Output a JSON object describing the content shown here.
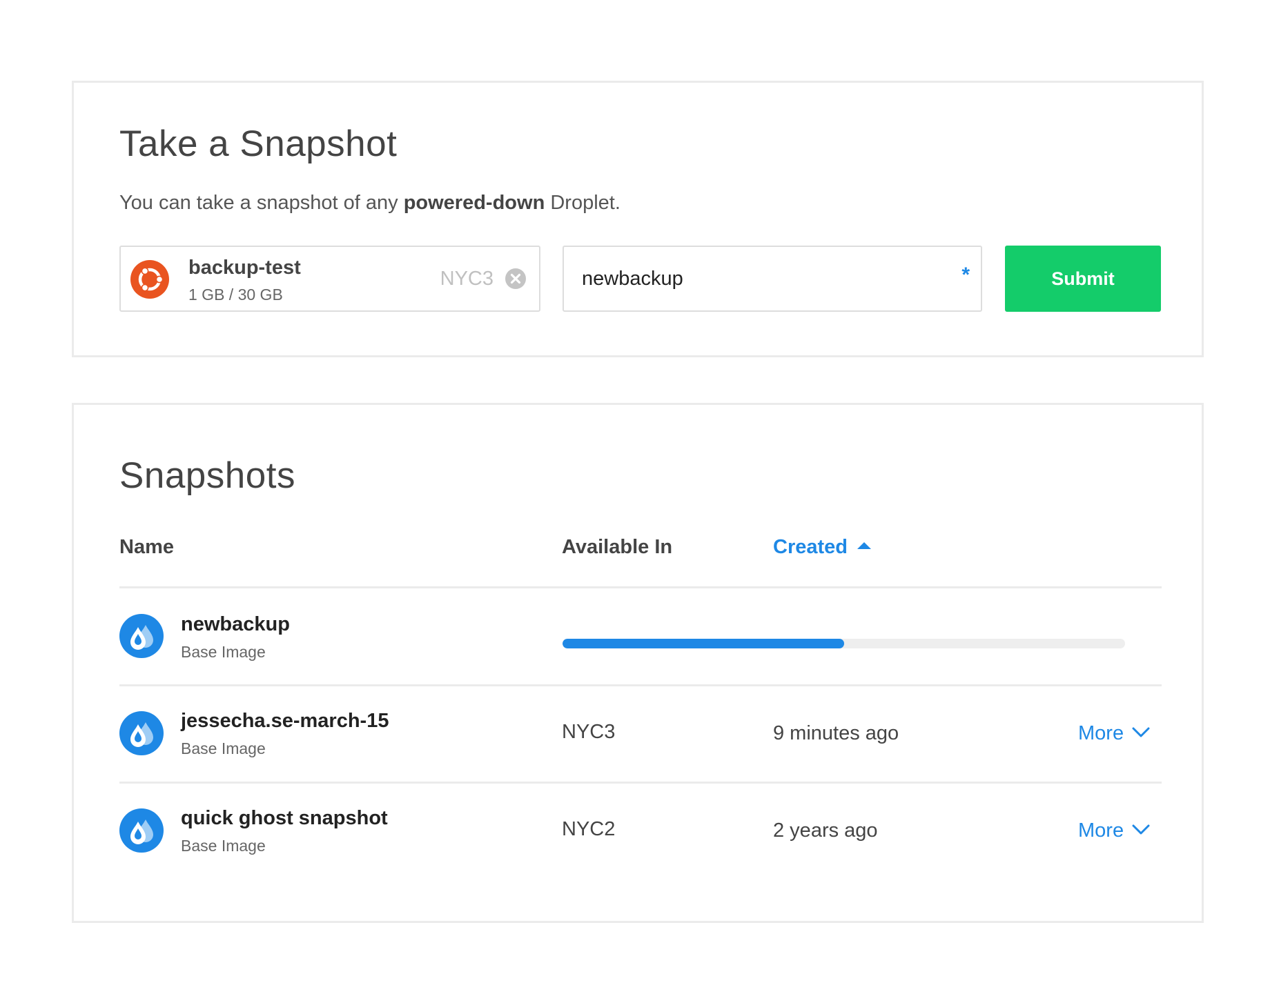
{
  "take_snapshot": {
    "title": "Take a Snapshot",
    "description_prefix": "You can take a snapshot of any ",
    "description_bold": "powered-down",
    "description_suffix": " Droplet.",
    "droplet": {
      "name": "backup-test",
      "size": "1 GB / 30 GB",
      "region": "NYC3",
      "icon": "ubuntu-icon"
    },
    "snapshot_name_value": "newbackup",
    "required_marker": "*",
    "submit_label": "Submit"
  },
  "snapshots": {
    "title": "Snapshots",
    "columns": {
      "name": "Name",
      "available_in": "Available In",
      "created": "Created"
    },
    "sort": {
      "column": "created",
      "direction": "ascending"
    },
    "rows": [
      {
        "name": "newbackup",
        "type": "Base Image",
        "progress": 0.5,
        "icon": "snapshot-droplet-icon"
      },
      {
        "name": "jessecha.se-march-15",
        "type": "Base Image",
        "region": "NYC3",
        "created": "9 minutes ago",
        "more_label": "More",
        "icon": "snapshot-droplet-icon"
      },
      {
        "name": "quick ghost snapshot",
        "type": "Base Image",
        "region": "NYC2",
        "created": "2 years ago",
        "more_label": "More",
        "icon": "snapshot-droplet-icon"
      }
    ]
  },
  "colors": {
    "accent_blue": "#1e88e5",
    "submit_green": "#14cc6a",
    "ubuntu_orange": "#e95420",
    "border_gray": "#ebebeb"
  }
}
